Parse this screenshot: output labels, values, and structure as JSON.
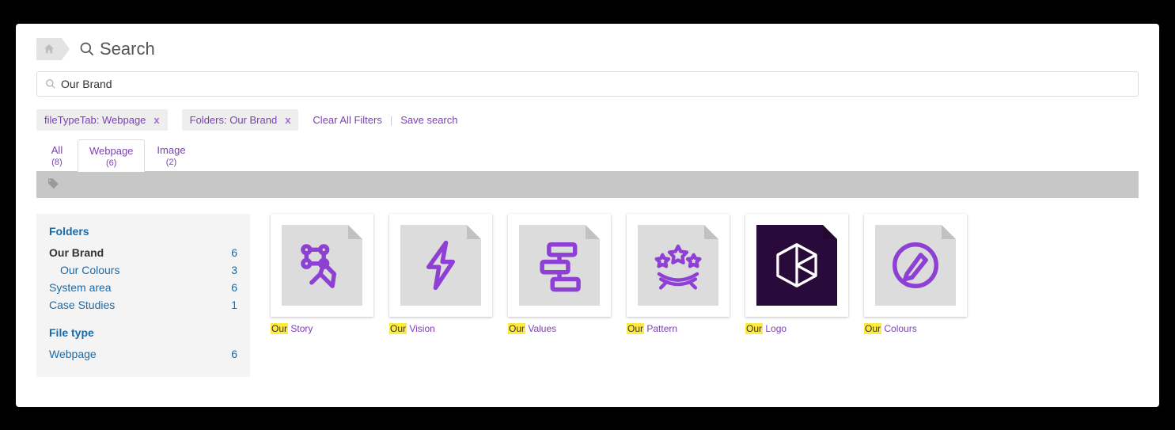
{
  "header": {
    "page_title": "Search"
  },
  "search": {
    "value": "Our Brand"
  },
  "filters": {
    "chips": [
      {
        "label": "fileTypeTab: Webpage"
      },
      {
        "label": "Folders: Our Brand"
      }
    ],
    "clear": "Clear All Filters",
    "save": "Save search"
  },
  "tabs": [
    {
      "label": "All",
      "count": "(8)",
      "active": false
    },
    {
      "label": "Webpage",
      "count": "(6)",
      "active": true
    },
    {
      "label": "Image",
      "count": "(2)",
      "active": false
    }
  ],
  "sidebar": {
    "folders_heading": "Folders",
    "filetype_heading": "File type",
    "folders": [
      {
        "label": "Our Brand",
        "count": "6",
        "selected": true,
        "child": false
      },
      {
        "label": "Our Colours",
        "count": "3",
        "selected": false,
        "child": true
      },
      {
        "label": "System area",
        "count": "6",
        "selected": false,
        "child": false
      },
      {
        "label": "Case Studies",
        "count": "1",
        "selected": false,
        "child": false
      }
    ],
    "filetypes": [
      {
        "label": "Webpage",
        "count": "6"
      }
    ]
  },
  "results": [
    {
      "highlight": "Our",
      "rest": " Story",
      "icon": "story",
      "bg": "#dcdcdc"
    },
    {
      "highlight": "Our",
      "rest": " Vision",
      "icon": "vision",
      "bg": "#dcdcdc"
    },
    {
      "highlight": "Our",
      "rest": " Values",
      "icon": "values",
      "bg": "#dcdcdc"
    },
    {
      "highlight": "Our",
      "rest": " Pattern",
      "icon": "pattern",
      "bg": "#dcdcdc"
    },
    {
      "highlight": "Our",
      "rest": " Logo",
      "icon": "logo",
      "bg": "#2a0a3a"
    },
    {
      "highlight": "Our",
      "rest": " Colours",
      "icon": "colours",
      "bg": "#dcdcdc"
    }
  ],
  "colors": {
    "purple": "#8e3fd4",
    "link": "#1a6aa8"
  }
}
